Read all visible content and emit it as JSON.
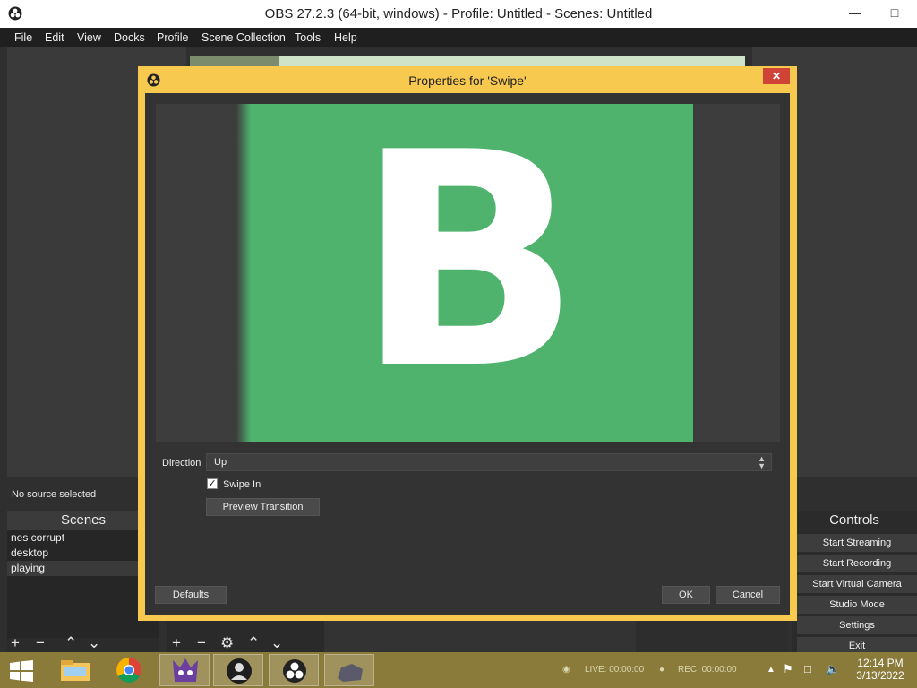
{
  "window": {
    "title": "OBS 27.2.3 (64-bit, windows) - Profile: Untitled - Scenes: Untitled"
  },
  "menu": [
    "File",
    "Edit",
    "View",
    "Docks",
    "Profile",
    "Scene Collection",
    "Tools",
    "Help"
  ],
  "source_status": "No source selected",
  "scenes": {
    "header": "Scenes",
    "items": [
      "nes corrupt",
      "desktop",
      "playing"
    ],
    "selected_index": 2
  },
  "controls": {
    "header": "Controls",
    "buttons": [
      "Start Streaming",
      "Start Recording",
      "Start Virtual Camera",
      "Studio Mode",
      "Settings",
      "Exit"
    ]
  },
  "dialog": {
    "title": "Properties for 'Swipe'",
    "preview_letter": "B",
    "direction_label": "Direction",
    "direction_value": "Up",
    "swipe_in_label": "Swipe In",
    "swipe_in_checked": true,
    "preview_button": "Preview Transition",
    "defaults_button": "Defaults",
    "ok_button": "OK",
    "cancel_button": "Cancel"
  },
  "status": {
    "live": "LIVE: 00:00:00",
    "rec": "REC: 00:00:00"
  },
  "clock": {
    "time": "12:14 PM",
    "date": "3/13/2022"
  },
  "colors": {
    "dialog_border": "#f7c94e",
    "preview_bg": "#4fb36e",
    "taskbar": "#8b7b3a",
    "close_button": "#d04437"
  }
}
